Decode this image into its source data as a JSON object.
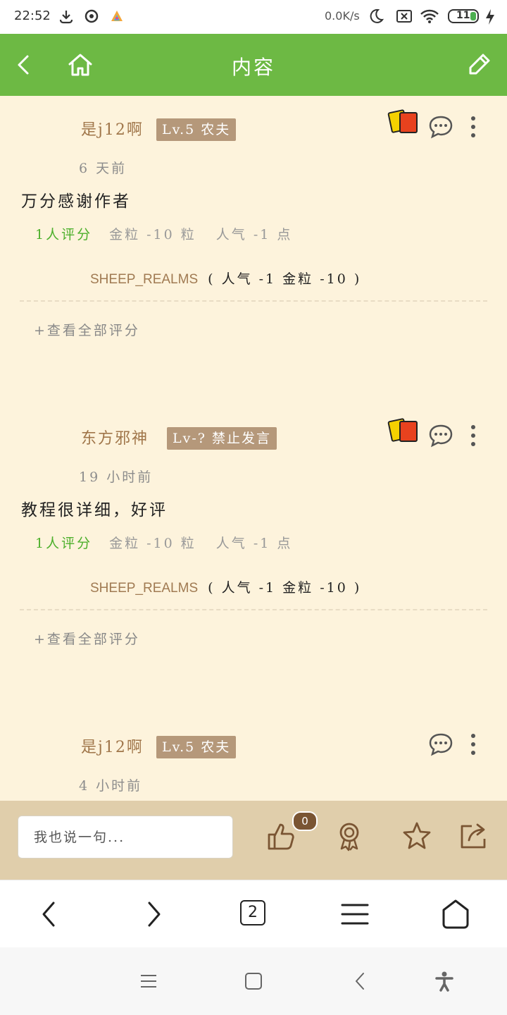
{
  "status_bar": {
    "time": "22:52",
    "speed": "0.0K/s",
    "battery": "11"
  },
  "app_bar": {
    "title": "内容"
  },
  "posts": [
    {
      "author": "是j12啊",
      "level_badge": "Lv.5 农夫",
      "time": "6 天前",
      "body": "万分感谢作者",
      "rating_count": "1人评分",
      "rating_gold": "金粒 -10 粒",
      "rating_popularity": "人气 -1 点",
      "rater_name": "SHEEP_REALMS",
      "rater_detail": "( 人气 -1 金粒 -10 )",
      "view_all": "+查看全部评分"
    },
    {
      "author": "东方邪神",
      "level_badge": "Lv-? 禁止发言",
      "time": "19 小时前",
      "body": "教程很详细，好评",
      "rating_count": "1人评分",
      "rating_gold": "金粒 -10 粒",
      "rating_popularity": "人气 -1 点",
      "rater_name": "SHEEP_REALMS",
      "rater_detail": "( 人气 -1 金粒 -10 )",
      "view_all": "+查看全部评分"
    },
    {
      "author": "是j12啊",
      "level_badge": "Lv.5 农夫",
      "time": "4 小时前"
    }
  ],
  "bottom_bar": {
    "comment_placeholder": "我也说一句...",
    "like_count": "0"
  },
  "browser": {
    "tab_count": "2"
  },
  "colors": {
    "app_bar": "#6db944",
    "background": "#fdf3dc",
    "bottom_bar": "#e0ceab",
    "badge": "#b5987a",
    "rating_green": "#4caf2b"
  }
}
